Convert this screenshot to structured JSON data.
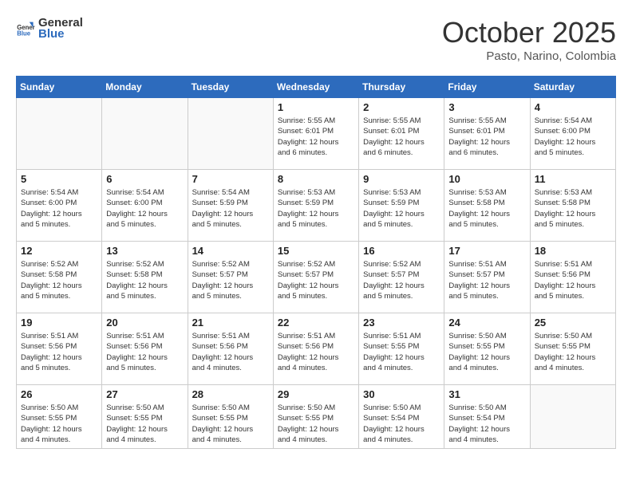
{
  "header": {
    "logo_general": "General",
    "logo_blue": "Blue",
    "month_title": "October 2025",
    "location": "Pasto, Narino, Colombia"
  },
  "weekdays": [
    "Sunday",
    "Monday",
    "Tuesday",
    "Wednesday",
    "Thursday",
    "Friday",
    "Saturday"
  ],
  "weeks": [
    [
      {
        "day": "",
        "info": ""
      },
      {
        "day": "",
        "info": ""
      },
      {
        "day": "",
        "info": ""
      },
      {
        "day": "1",
        "info": "Sunrise: 5:55 AM\nSunset: 6:01 PM\nDaylight: 12 hours\nand 6 minutes."
      },
      {
        "day": "2",
        "info": "Sunrise: 5:55 AM\nSunset: 6:01 PM\nDaylight: 12 hours\nand 6 minutes."
      },
      {
        "day": "3",
        "info": "Sunrise: 5:55 AM\nSunset: 6:01 PM\nDaylight: 12 hours\nand 6 minutes."
      },
      {
        "day": "4",
        "info": "Sunrise: 5:54 AM\nSunset: 6:00 PM\nDaylight: 12 hours\nand 5 minutes."
      }
    ],
    [
      {
        "day": "5",
        "info": "Sunrise: 5:54 AM\nSunset: 6:00 PM\nDaylight: 12 hours\nand 5 minutes."
      },
      {
        "day": "6",
        "info": "Sunrise: 5:54 AM\nSunset: 6:00 PM\nDaylight: 12 hours\nand 5 minutes."
      },
      {
        "day": "7",
        "info": "Sunrise: 5:54 AM\nSunset: 5:59 PM\nDaylight: 12 hours\nand 5 minutes."
      },
      {
        "day": "8",
        "info": "Sunrise: 5:53 AM\nSunset: 5:59 PM\nDaylight: 12 hours\nand 5 minutes."
      },
      {
        "day": "9",
        "info": "Sunrise: 5:53 AM\nSunset: 5:59 PM\nDaylight: 12 hours\nand 5 minutes."
      },
      {
        "day": "10",
        "info": "Sunrise: 5:53 AM\nSunset: 5:58 PM\nDaylight: 12 hours\nand 5 minutes."
      },
      {
        "day": "11",
        "info": "Sunrise: 5:53 AM\nSunset: 5:58 PM\nDaylight: 12 hours\nand 5 minutes."
      }
    ],
    [
      {
        "day": "12",
        "info": "Sunrise: 5:52 AM\nSunset: 5:58 PM\nDaylight: 12 hours\nand 5 minutes."
      },
      {
        "day": "13",
        "info": "Sunrise: 5:52 AM\nSunset: 5:58 PM\nDaylight: 12 hours\nand 5 minutes."
      },
      {
        "day": "14",
        "info": "Sunrise: 5:52 AM\nSunset: 5:57 PM\nDaylight: 12 hours\nand 5 minutes."
      },
      {
        "day": "15",
        "info": "Sunrise: 5:52 AM\nSunset: 5:57 PM\nDaylight: 12 hours\nand 5 minutes."
      },
      {
        "day": "16",
        "info": "Sunrise: 5:52 AM\nSunset: 5:57 PM\nDaylight: 12 hours\nand 5 minutes."
      },
      {
        "day": "17",
        "info": "Sunrise: 5:51 AM\nSunset: 5:57 PM\nDaylight: 12 hours\nand 5 minutes."
      },
      {
        "day": "18",
        "info": "Sunrise: 5:51 AM\nSunset: 5:56 PM\nDaylight: 12 hours\nand 5 minutes."
      }
    ],
    [
      {
        "day": "19",
        "info": "Sunrise: 5:51 AM\nSunset: 5:56 PM\nDaylight: 12 hours\nand 5 minutes."
      },
      {
        "day": "20",
        "info": "Sunrise: 5:51 AM\nSunset: 5:56 PM\nDaylight: 12 hours\nand 5 minutes."
      },
      {
        "day": "21",
        "info": "Sunrise: 5:51 AM\nSunset: 5:56 PM\nDaylight: 12 hours\nand 4 minutes."
      },
      {
        "day": "22",
        "info": "Sunrise: 5:51 AM\nSunset: 5:56 PM\nDaylight: 12 hours\nand 4 minutes."
      },
      {
        "day": "23",
        "info": "Sunrise: 5:51 AM\nSunset: 5:55 PM\nDaylight: 12 hours\nand 4 minutes."
      },
      {
        "day": "24",
        "info": "Sunrise: 5:50 AM\nSunset: 5:55 PM\nDaylight: 12 hours\nand 4 minutes."
      },
      {
        "day": "25",
        "info": "Sunrise: 5:50 AM\nSunset: 5:55 PM\nDaylight: 12 hours\nand 4 minutes."
      }
    ],
    [
      {
        "day": "26",
        "info": "Sunrise: 5:50 AM\nSunset: 5:55 PM\nDaylight: 12 hours\nand 4 minutes."
      },
      {
        "day": "27",
        "info": "Sunrise: 5:50 AM\nSunset: 5:55 PM\nDaylight: 12 hours\nand 4 minutes."
      },
      {
        "day": "28",
        "info": "Sunrise: 5:50 AM\nSunset: 5:55 PM\nDaylight: 12 hours\nand 4 minutes."
      },
      {
        "day": "29",
        "info": "Sunrise: 5:50 AM\nSunset: 5:55 PM\nDaylight: 12 hours\nand 4 minutes."
      },
      {
        "day": "30",
        "info": "Sunrise: 5:50 AM\nSunset: 5:54 PM\nDaylight: 12 hours\nand 4 minutes."
      },
      {
        "day": "31",
        "info": "Sunrise: 5:50 AM\nSunset: 5:54 PM\nDaylight: 12 hours\nand 4 minutes."
      },
      {
        "day": "",
        "info": ""
      }
    ]
  ]
}
